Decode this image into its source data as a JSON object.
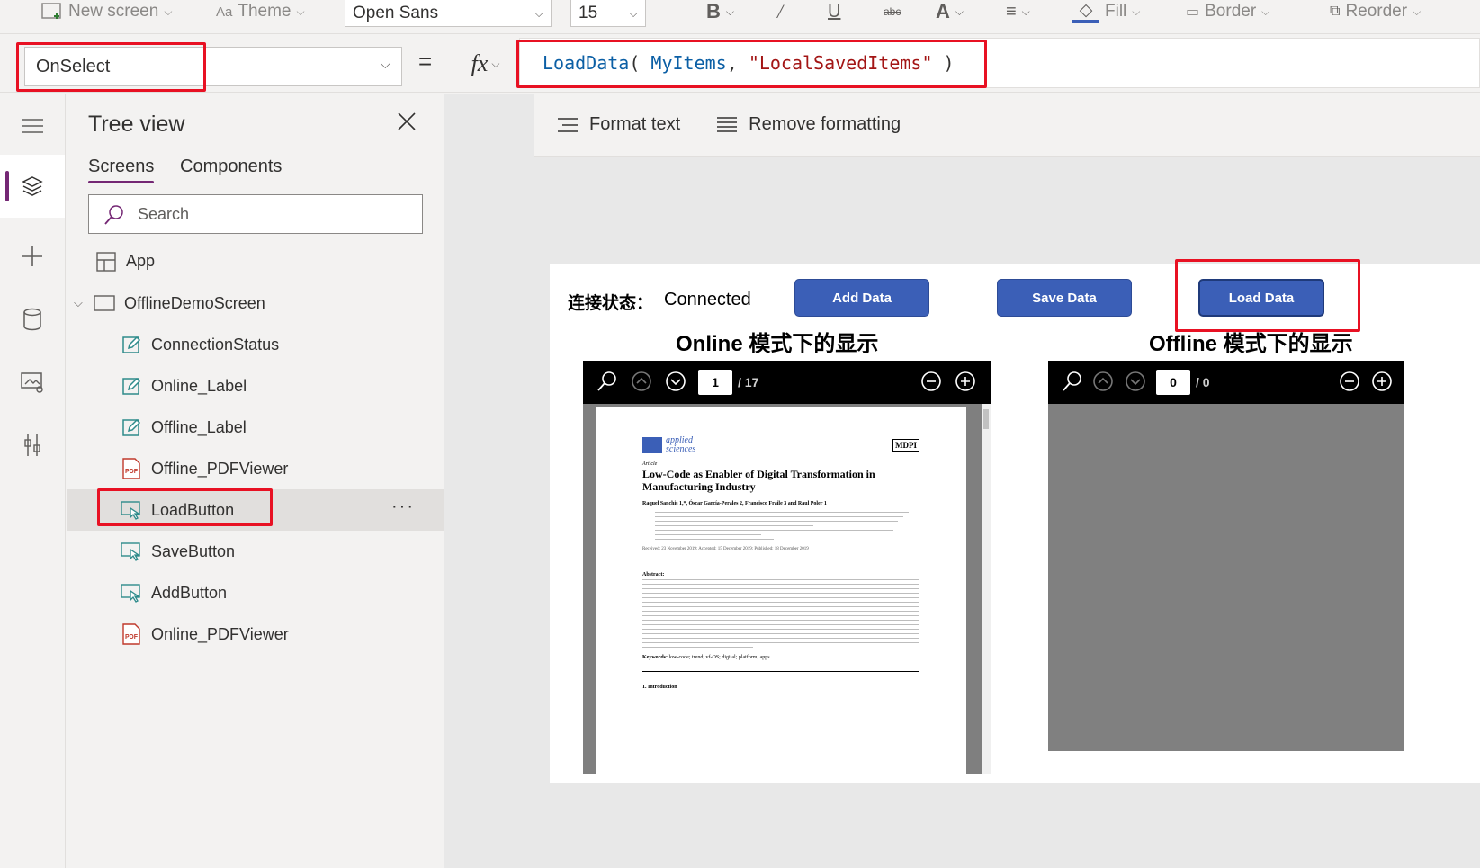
{
  "ribbon": {
    "new_screen": "New screen",
    "theme": "Theme",
    "font": "Open Sans",
    "font_size": "15",
    "fill": "Fill",
    "border": "Border",
    "reorder": "Reorder"
  },
  "formula_bar": {
    "property": "OnSelect",
    "equals": "=",
    "fx": "fx",
    "fn": "LoadData",
    "open": "( ",
    "arg1": "MyItems",
    "comma": ", ",
    "arg2": "\"LocalSavedItems\"",
    "close": " )"
  },
  "format_bar": {
    "format_text": "Format text",
    "remove_formatting": "Remove formatting"
  },
  "tree_view": {
    "title": "Tree view",
    "tabs": {
      "screens": "Screens",
      "components": "Components"
    },
    "search_placeholder": "Search",
    "app": "App",
    "screen": "OfflineDemoScreen",
    "items": [
      {
        "label": "ConnectionStatus",
        "icon": "label-edit-icon"
      },
      {
        "label": "Online_Label",
        "icon": "label-edit-icon"
      },
      {
        "label": "Offline_Label",
        "icon": "label-edit-icon"
      },
      {
        "label": "Offline_PDFViewer",
        "icon": "pdf-icon"
      },
      {
        "label": "LoadButton",
        "icon": "button-icon"
      },
      {
        "label": "SaveButton",
        "icon": "button-icon"
      },
      {
        "label": "AddButton",
        "icon": "button-icon"
      },
      {
        "label": "Online_PDFViewer",
        "icon": "pdf-icon"
      }
    ],
    "more": "···"
  },
  "app_screen": {
    "status_label": "连接状态：",
    "status_value": "Connected",
    "add_button": "Add Data",
    "save_button": "Save Data",
    "load_button": "Load Data",
    "online_title": "Online 模式下的显示",
    "offline_title": "Offline 模式下的显示",
    "online_pdf": {
      "page": "1",
      "total": "/ 17"
    },
    "offline_pdf": {
      "page": "0",
      "total": "/ 0"
    }
  },
  "paper": {
    "journal": "applied\nsciences",
    "publisher": "MDPI",
    "type": "Article",
    "title": "Low-Code as Enabler of Digital Transformation in Manufacturing Industry",
    "authors": "Raquel Sanchis 1,*, Óscar García-Perales 2, Francisco Fraile 3 and Raul Poler 1",
    "dates": "Received: 23 November 2019; Accepted: 15 December 2019; Published: 18 December 2019",
    "abstract_head": "Abstract:",
    "keywords_head": "Keywords:",
    "keywords": "low-code; trend; vf-OS; digital; platform; apps",
    "section": "1. Introduction"
  },
  "colors": {
    "accent": "#742774",
    "button": "#3b5fb7",
    "highlight": "#e81123",
    "code_fn": "#0b5fa5",
    "code_var": "#0b5fa5",
    "code_str": "#a31515"
  }
}
